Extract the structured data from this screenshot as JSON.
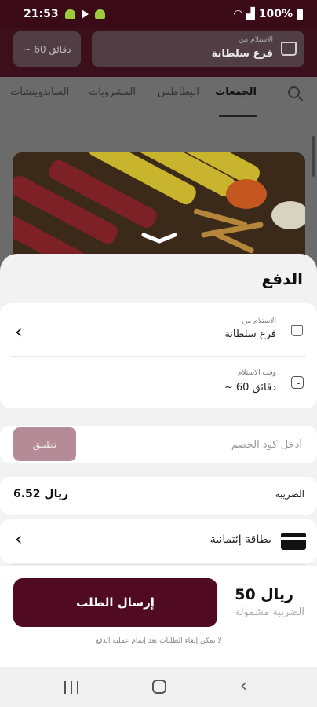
{
  "status_bar": {
    "time": "21:53",
    "battery": "100%"
  },
  "header": {
    "branch_label": "الاستلام من",
    "branch_value": "فرع سلطانة",
    "time_value": "~ 60 دقائق"
  },
  "tabs": [
    {
      "label": "الجمعات",
      "active": true
    },
    {
      "label": "البطاطس",
      "active": false
    },
    {
      "label": "المشروبات",
      "active": false
    },
    {
      "label": "الساندويتشات",
      "active": false
    }
  ],
  "payment": {
    "title": "الدفع",
    "pickup_label": "الاستلام من",
    "pickup_value": "فرع سلطانة",
    "time_label": "وقت الاستلام",
    "time_value": "~ 60 دقائق",
    "coupon_placeholder": "أدخل كود الخصم",
    "apply_label": "تطبيق",
    "tax_label": "الضريبة",
    "tax_value": "6.52 ريال",
    "payment_method": "بطاقة إئتمانية",
    "submit_label": "إرسال الطلب",
    "total": "50 ريال",
    "total_note": "الضريبة مشمولة",
    "cancel_note": "لا يمكن إلغاء الطلبات بعد  إتمام عملية الدفع"
  },
  "colors": {
    "brand": "#500b22",
    "apply_button": "#b58b97",
    "status_bar": "#3a0a16"
  }
}
